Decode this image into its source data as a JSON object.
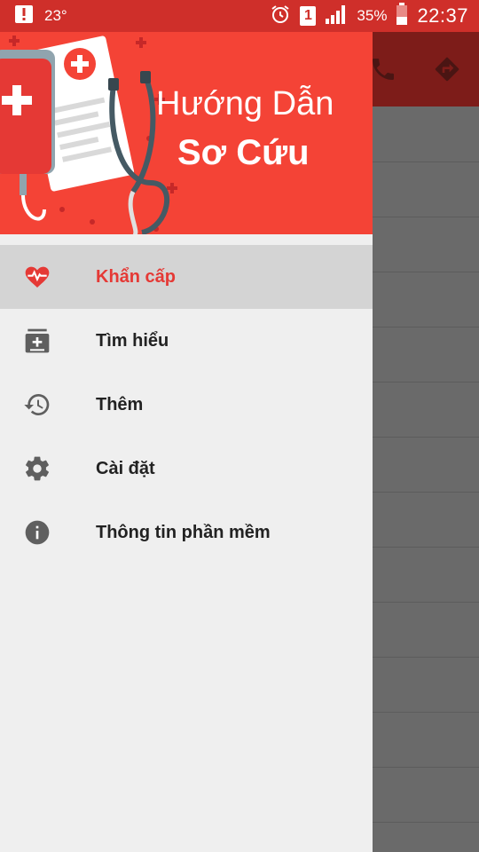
{
  "status_bar": {
    "temperature": "23°",
    "sim_slot": "1",
    "battery_percent": "35%",
    "time": "22:37"
  },
  "drawer": {
    "header": {
      "title_line1": "Hướng Dẫn",
      "title_line2": "Sơ Cứu"
    },
    "items": [
      {
        "label": "Khẩn cấp",
        "icon": "heart-pulse-icon",
        "active": true
      },
      {
        "label": "Tìm hiểu",
        "icon": "medical-card-icon",
        "active": false
      },
      {
        "label": "Thêm",
        "icon": "history-icon",
        "active": false
      },
      {
        "label": "Cài đặt",
        "icon": "gear-icon",
        "active": false
      },
      {
        "label": "Thông tin phần mềm",
        "icon": "info-icon",
        "active": false
      }
    ]
  },
  "colors": {
    "status_bar": "#cf2f2a",
    "header": "#f44336",
    "active_text": "#e53935",
    "icon_gray": "#5f5f5f"
  }
}
